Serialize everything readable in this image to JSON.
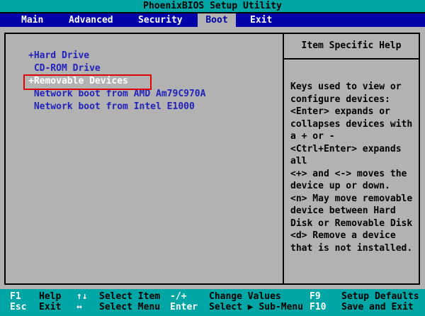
{
  "window": {
    "title": "PhoenixBIOS Setup Utility"
  },
  "menu": {
    "tabs": [
      "Main",
      "Advanced",
      "Security",
      "Boot",
      "Exit"
    ],
    "active_tab": "Boot"
  },
  "boot": {
    "items": [
      {
        "text": "+Hard Drive",
        "selected": false
      },
      {
        "text": " CD-ROM Drive",
        "selected": false
      },
      {
        "text": "+Removable Devices",
        "selected": true
      },
      {
        "text": " Network boot from AMD Am79C970A",
        "selected": false
      },
      {
        "text": " Network boot from Intel E1000",
        "selected": false
      }
    ],
    "highlight_color": "#e10000"
  },
  "help": {
    "title": "Item Specific Help",
    "lines": [
      "Keys used to view or",
      "configure devices:",
      "<Enter> expands or",
      "collapses devices with",
      "a + or -",
      "<Ctrl+Enter> expands",
      "all",
      "<+> and <-> moves the",
      "device up or down.",
      "<n> May move removable",
      "device between Hard",
      "Disk or Removable Disk",
      "<d> Remove a device",
      "that is not installed."
    ]
  },
  "footer": {
    "row1": [
      {
        "key": "F1",
        "label": "Help"
      },
      {
        "key": "↑↓",
        "label": "Select Item"
      },
      {
        "key": "-/+",
        "label": "Change Values"
      },
      {
        "key": "F9",
        "label": "Setup Defaults"
      }
    ],
    "row2": [
      {
        "key": "Esc",
        "label": "Exit"
      },
      {
        "key": "↔",
        "label": "Select Menu"
      },
      {
        "key": "Enter",
        "label": "Select ▶ Sub-Menu"
      },
      {
        "key": "F10",
        "label": "Save and Exit"
      }
    ]
  },
  "colors": {
    "teal_bar": "#00a5a5",
    "menu_blue": "#0000a8",
    "panel_gray": "#b2b2b2",
    "item_blue": "#2222bb",
    "selected_text": "#ffffff",
    "highlight_red": "#e10000",
    "text_black": "#000000"
  }
}
